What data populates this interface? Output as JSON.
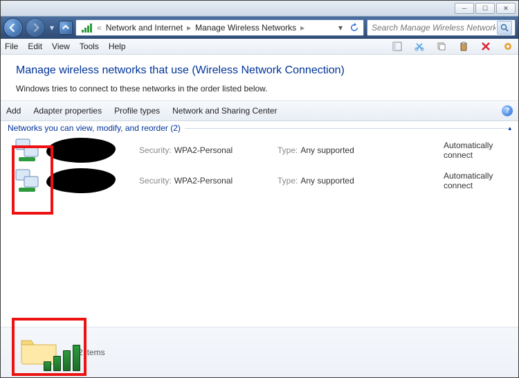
{
  "titlebar": {
    "min": "─",
    "max": "☐",
    "close": "✕"
  },
  "nav": {
    "crumbs": [
      "Network and Internet",
      "Manage Wireless Networks"
    ],
    "search_placeholder": "Search Manage Wireless Networks"
  },
  "menu": {
    "file": "File",
    "edit": "Edit",
    "view": "View",
    "tools": "Tools",
    "help": "Help"
  },
  "header": {
    "title": "Manage wireless networks that use (Wireless Network Connection)",
    "subtitle": "Windows tries to connect to these networks in the order listed below."
  },
  "cmd": {
    "add": "Add",
    "adapter": "Adapter properties",
    "profile": "Profile types",
    "nsc": "Network and Sharing Center"
  },
  "section": {
    "label": "Networks you can view, modify, and reorder (2)"
  },
  "labels": {
    "security": "Security:",
    "type": "Type:"
  },
  "rows": [
    {
      "security": "WPA2-Personal",
      "type": "Any supported",
      "conn": "Automatically connect"
    },
    {
      "security": "WPA2-Personal",
      "type": "Any supported",
      "conn": "Automatically connect"
    }
  ],
  "details": {
    "items": "2 items"
  }
}
